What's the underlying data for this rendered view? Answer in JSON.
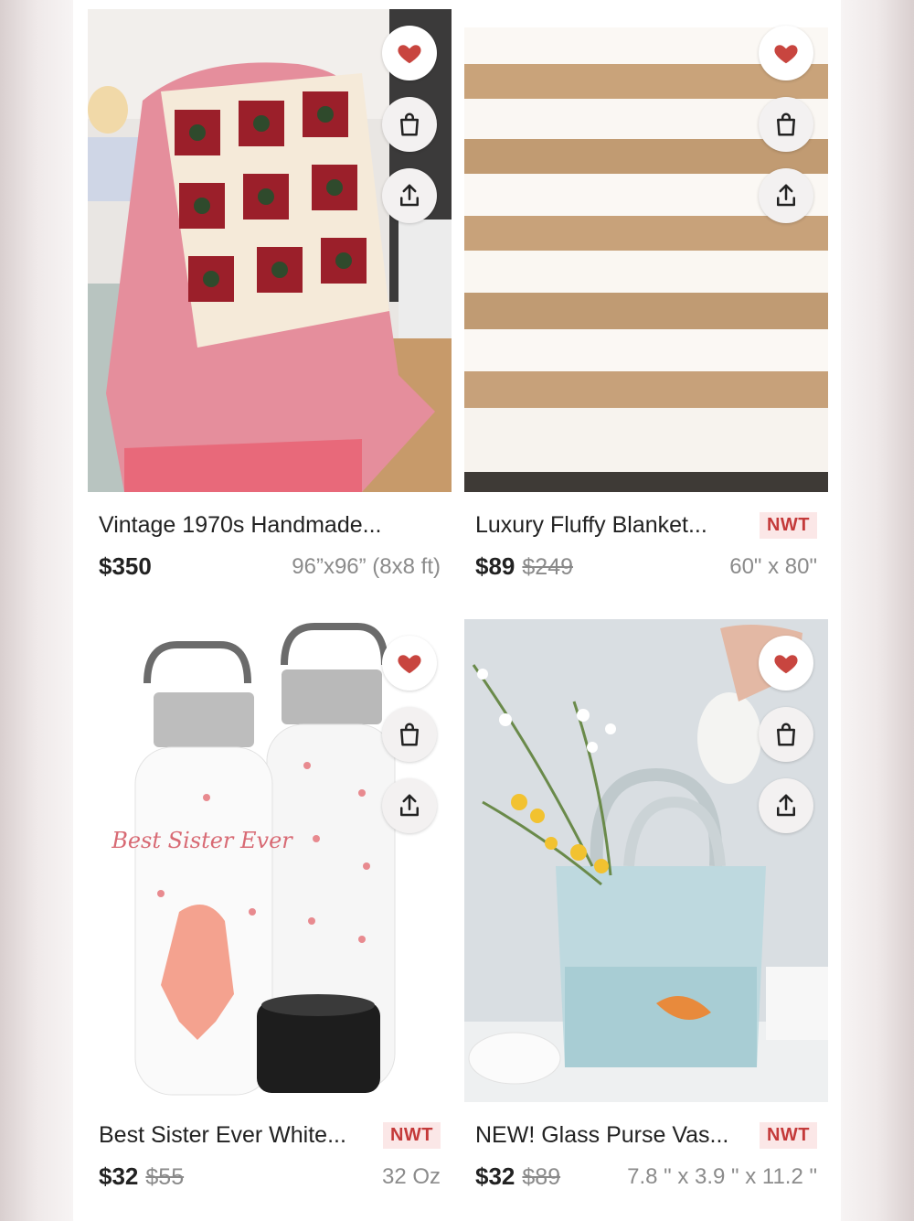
{
  "listings": [
    {
      "title": "Vintage 1970s Handmade...",
      "price": "$350",
      "original_price": "",
      "size": "96”x96” (8x8 ft)",
      "badge": ""
    },
    {
      "title": "Luxury Fluffy Blanket...",
      "price": "$89",
      "original_price": "$249",
      "size": "60\" x 80\"",
      "badge": "NWT"
    },
    {
      "title": "Best Sister Ever White...",
      "price": "$32",
      "original_price": "$55",
      "size": "32 Oz",
      "badge": "NWT"
    },
    {
      "title": "NEW! Glass Purse Vas...",
      "price": "$32",
      "original_price": "$89",
      "size": "7.8 \" x 3.9 \" x 11.2 \"",
      "badge": "NWT"
    }
  ],
  "bottle_text": "Best Sister Ever",
  "icons": {
    "like": "heart-icon",
    "bag": "shopping-bag-icon",
    "share": "share-icon"
  },
  "colors": {
    "heart": "#c8453f",
    "badge_text": "#c43a3a",
    "badge_bg": "#fbe7e7",
    "strike": "#8a8a8a"
  }
}
